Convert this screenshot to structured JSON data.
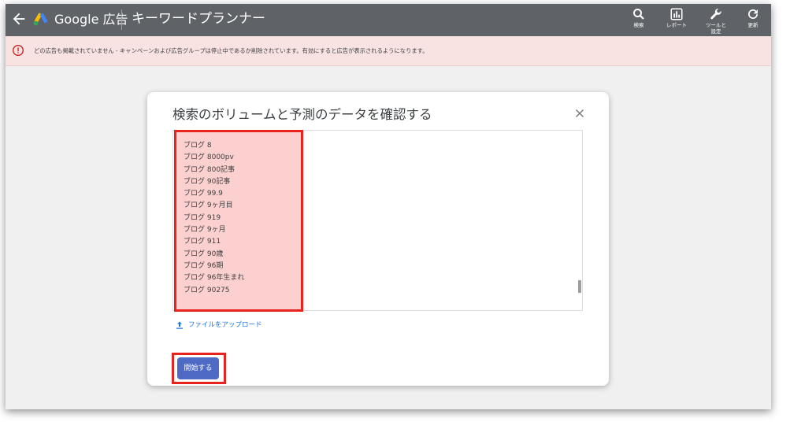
{
  "app": {
    "brand": "Google 広告",
    "page_title": "キーワードプランナー"
  },
  "toolbar": [
    {
      "icon": "search-icon",
      "label": "検索"
    },
    {
      "icon": "report-icon",
      "label": "レポート"
    },
    {
      "icon": "wrench-icon",
      "label": "ツールと設定"
    },
    {
      "icon": "refresh-icon",
      "label": "更新"
    }
  ],
  "banner": {
    "icon": "alert-icon",
    "text": "どの広告も掲載されていません - キャンペーンおよび広告グループは停止中であるか削除されています。有効にすると広告が表示されるようになります。"
  },
  "dialog": {
    "title": "検索のボリュームと予測のデータを確認する",
    "keywords": [
      "ブログ 8",
      "ブログ 8000pv",
      "ブログ 800記事",
      "ブログ 90記事",
      "ブログ 99.9",
      "ブログ 9ヶ月目",
      "ブログ 919",
      "ブログ 9ヶ月",
      "ブログ 911",
      "ブログ 90歳",
      "ブログ 96期",
      "ブログ 96年生まれ",
      "ブログ 90275"
    ],
    "upload_label": "ファイルをアップロード",
    "start_label": "開始する"
  },
  "colors": {
    "topbar": "#5f6368",
    "banner_bg": "#f9e3e2",
    "highlight_border": "#e8231f",
    "highlight_fill": "#fcd0cf",
    "primary_button": "#4f6ac4",
    "link": "#1a73e8"
  }
}
